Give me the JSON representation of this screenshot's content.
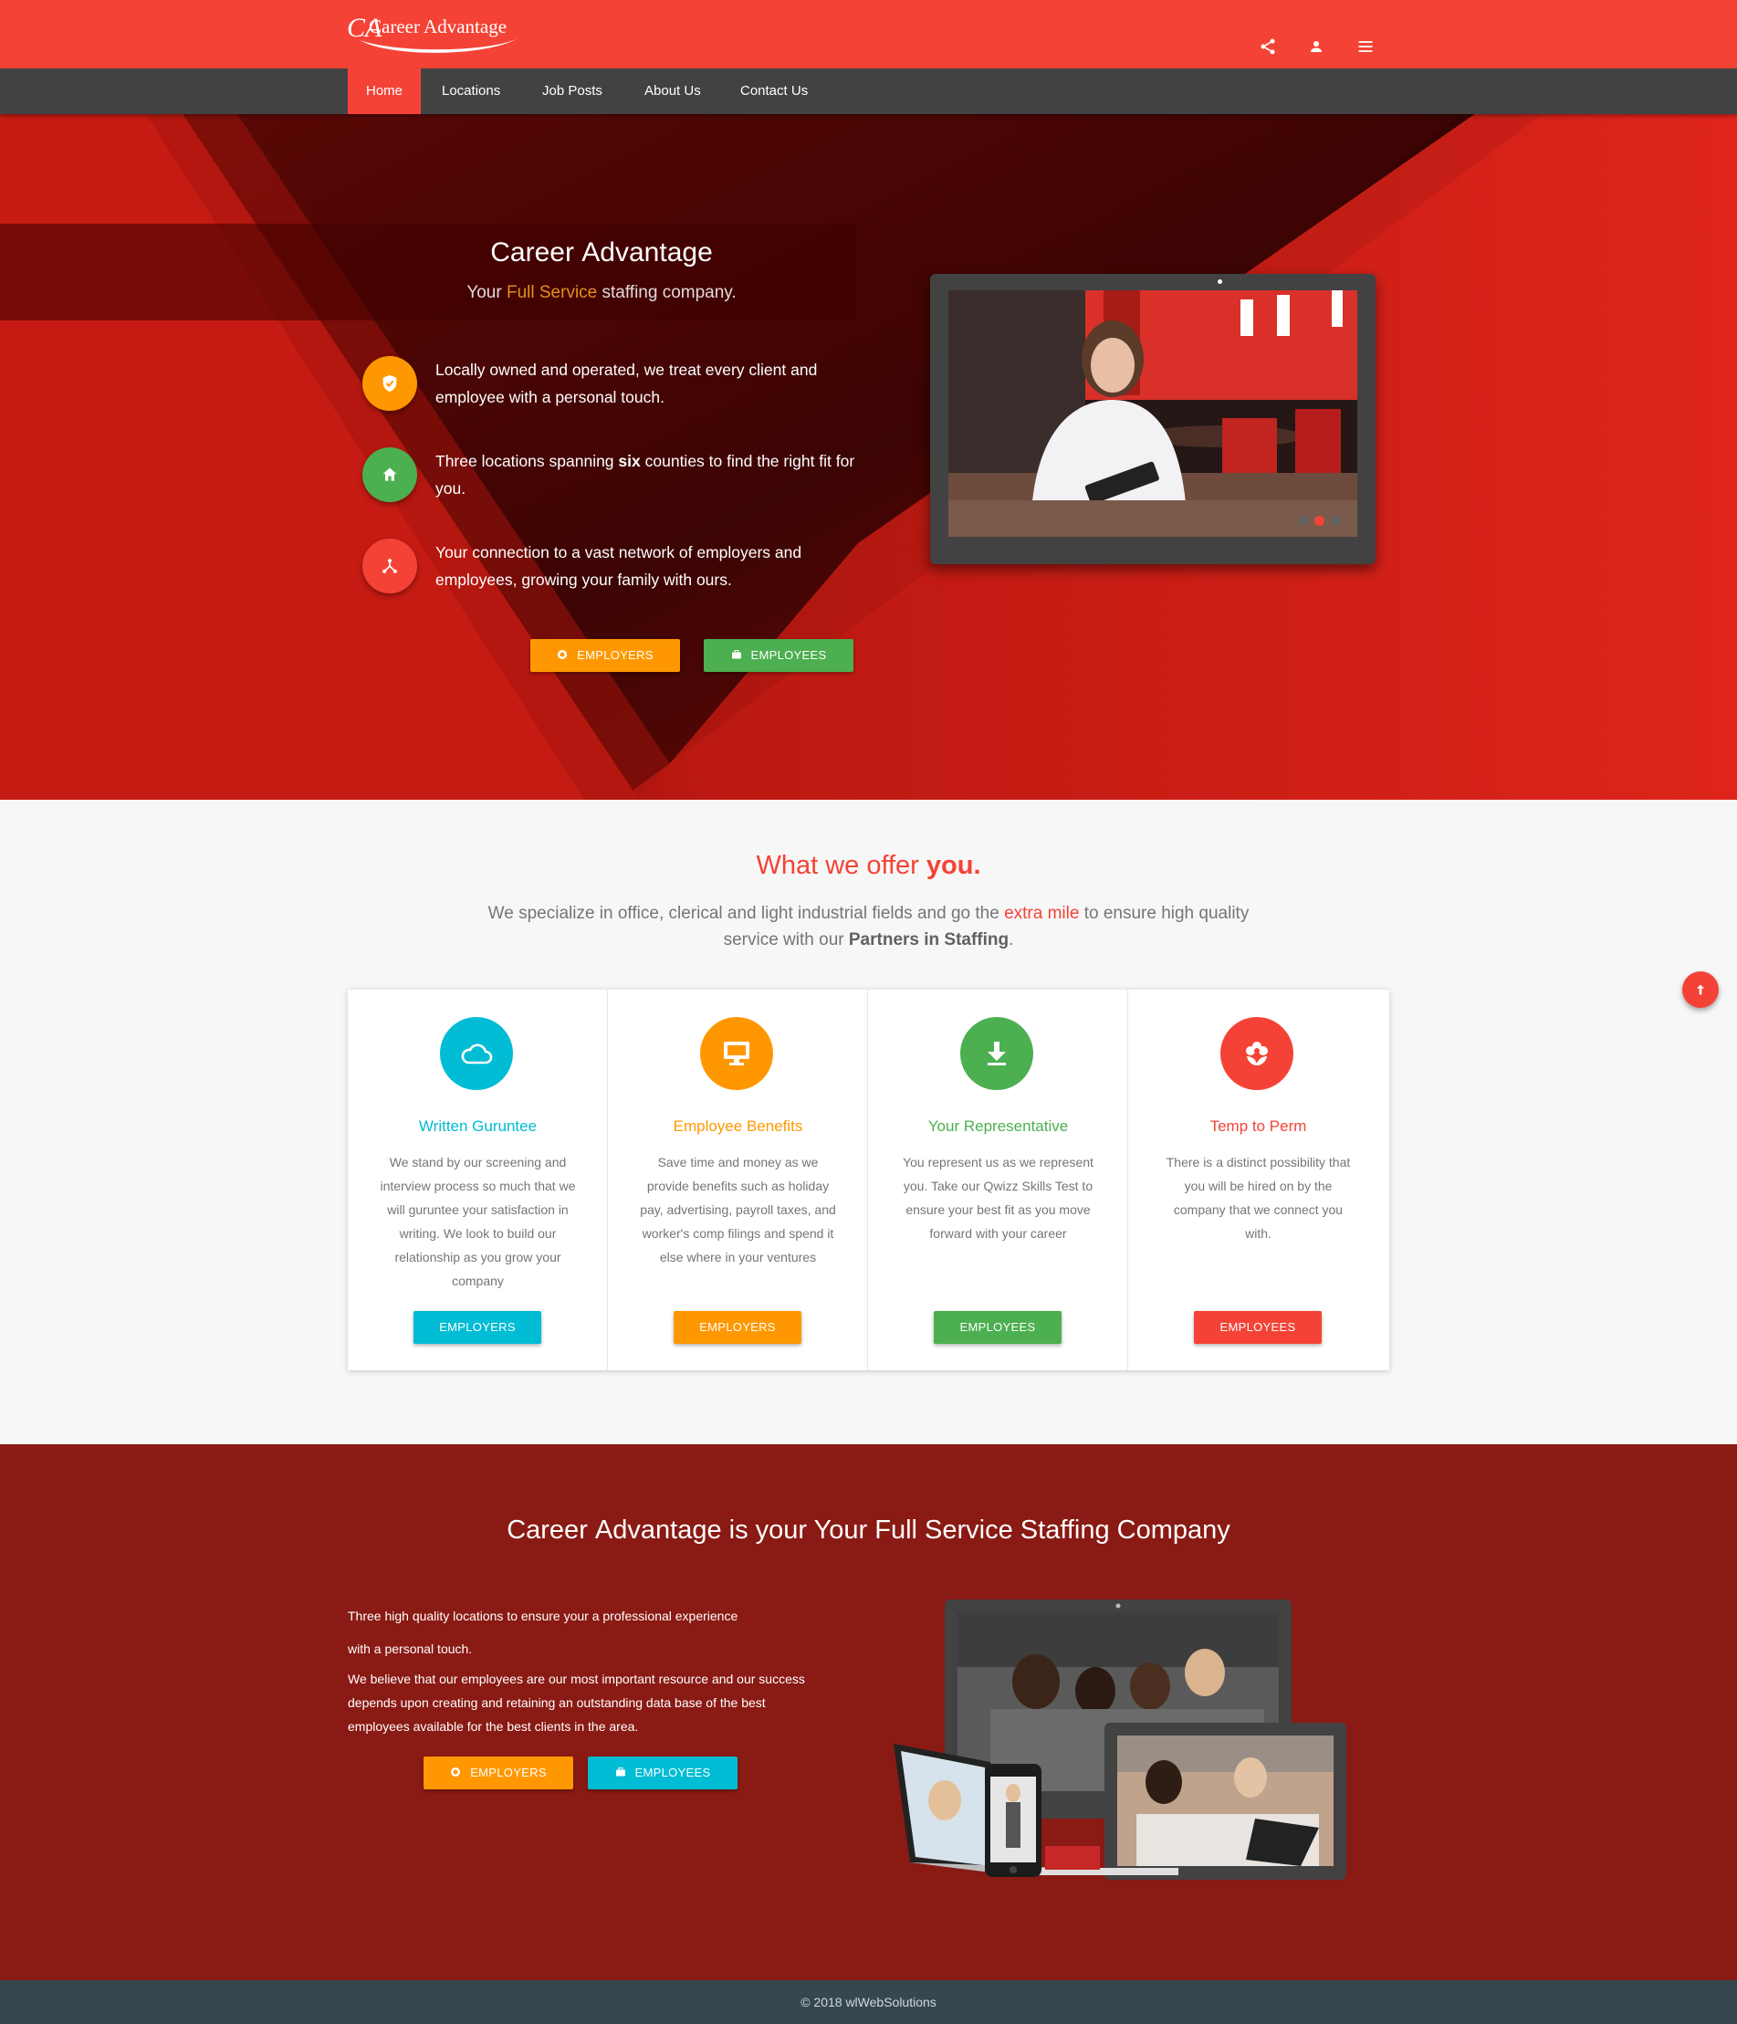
{
  "header": {
    "logo_monogram": "CA",
    "logo_text": "Career Advantage",
    "icons": [
      "share-icon",
      "account-icon",
      "menu-icon"
    ]
  },
  "nav": {
    "items": [
      {
        "label": "Home",
        "active": true
      },
      {
        "label": "Locations",
        "active": false
      },
      {
        "label": "Job Posts",
        "active": false
      },
      {
        "label": "About Us",
        "active": false
      },
      {
        "label": "Contact Us",
        "active": false
      }
    ]
  },
  "hero": {
    "title_light": "Career",
    "title_bold": "Advantage",
    "subtitle_pre": "Your",
    "subtitle_hl": "Full Service",
    "subtitle_post": "staffing company.",
    "features": [
      {
        "icon": "shield-check-icon",
        "color": "#ff9800",
        "text": "Locally owned and operated, we treat every client and employee with a personal touch."
      },
      {
        "icon": "home-icon",
        "color": "#4caf50",
        "text_pre": "Three locations spanning",
        "text_bold": "six",
        "text_post": "counties to find the right fit for you."
      },
      {
        "icon": "network-icon",
        "color": "#f44336",
        "text": "Your connection to a vast network of employers and employees, growing your family with ours."
      }
    ],
    "buttons": [
      {
        "label": "EMPLOYERS",
        "icon": "globe-icon",
        "color": "#ff9800"
      },
      {
        "label": "EMPLOYEES",
        "icon": "briefcase-icon",
        "color": "#4caf50"
      }
    ],
    "carousel": {
      "slides": 3,
      "active_index": 1
    }
  },
  "offer": {
    "title_pre": "What we offer",
    "title_bold": "you.",
    "lead_pre": "We specialize in office, clerical and light industrial fields and go the",
    "lead_hl": "extra mile",
    "lead_mid": "to ensure high quality service with our",
    "lead_bold": "Partners in Staffing",
    "lead_post": ".",
    "cards": [
      {
        "icon": "cloud-icon",
        "color": "#00bcd4",
        "title": "Written Guruntee",
        "body": "We stand by our screening and interview process so much that we will guruntee your satisfaction in writing. We look to build our relationship as you grow your company",
        "button": "EMPLOYERS"
      },
      {
        "icon": "monitor-icon",
        "color": "#ff9800",
        "title": "Employee Benefits",
        "body": "Save time and money as we provide benefits such as holiday pay, advertising, payroll taxes, and worker's comp filings and spend it else where in your ventures",
        "button": "EMPLOYERS"
      },
      {
        "icon": "download-icon",
        "color": "#4caf50",
        "title": "Your Representative",
        "body": "You represent us as we represent you. Take our Qwizz Skills Test to ensure your best fit as you move forward with your career",
        "button": "EMPLOYEES"
      },
      {
        "icon": "flower-icon",
        "color": "#f44336",
        "title": "Temp to Perm",
        "body": "There is a distinct possibility that you will be hired on by the company that we connect you with.",
        "button": "EMPLOYEES"
      }
    ]
  },
  "about": {
    "title_light": "Career",
    "title_bold": "Advantage",
    "title_post": "is your Your Full Service Staffing Company",
    "p1_line1": "Three high quality locations to ensure your a professional experience",
    "p1_line2": "with a personal touch.",
    "p2": "We believe that our employees are our most important resource and our success depends upon creating and retaining an outstanding data base of the best employees available for the best clients in the area.",
    "buttons": [
      {
        "label": "EMPLOYERS",
        "icon": "globe-icon",
        "color": "#ff9800"
      },
      {
        "label": "EMPLOYEES",
        "icon": "briefcase-icon",
        "color": "#00bcd4"
      }
    ]
  },
  "footer": {
    "text": "© 2018 wlWebSolutions"
  }
}
